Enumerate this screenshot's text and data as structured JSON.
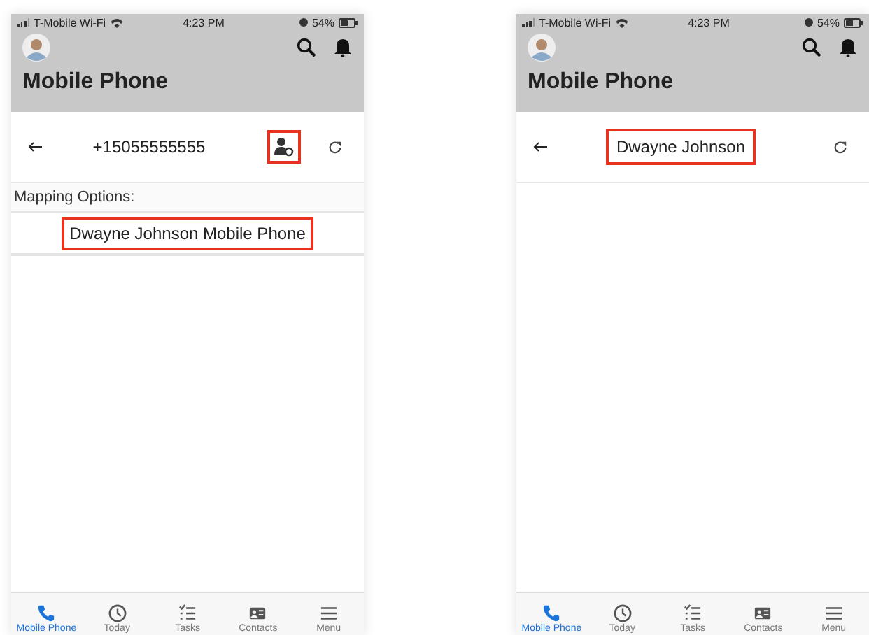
{
  "screens": [
    {
      "status_bar": {
        "carrier": "T-Mobile Wi-Fi",
        "time": "4:23 PM",
        "battery": "54%"
      },
      "header": {
        "title": "Mobile Phone"
      },
      "toolbar": {
        "title": "+15055555555",
        "title_highlighted": false,
        "actions": [
          {
            "kind": "map-contact",
            "highlighted": true
          },
          {
            "kind": "refresh",
            "highlighted": false
          }
        ]
      },
      "mapping_label": "Mapping Options:",
      "options": [
        {
          "label": "Dwayne Johnson Mobile Phone",
          "highlighted": true
        }
      ],
      "tabs": [
        {
          "label": "Mobile Phone",
          "kind": "phone",
          "selected": true
        },
        {
          "label": "Today",
          "kind": "clock",
          "selected": false
        },
        {
          "label": "Tasks",
          "kind": "tasks",
          "selected": false
        },
        {
          "label": "Contacts",
          "kind": "contacts",
          "selected": false
        },
        {
          "label": "Menu",
          "kind": "menu",
          "selected": false
        }
      ]
    },
    {
      "status_bar": {
        "carrier": "T-Mobile Wi-Fi",
        "time": "4:23 PM",
        "battery": "54%"
      },
      "header": {
        "title": "Mobile Phone"
      },
      "toolbar": {
        "title": "Dwayne Johnson",
        "title_highlighted": true,
        "actions": [
          {
            "kind": "refresh",
            "highlighted": false
          }
        ]
      },
      "tabs": [
        {
          "label": "Mobile Phone",
          "kind": "phone",
          "selected": true
        },
        {
          "label": "Today",
          "kind": "clock",
          "selected": false
        },
        {
          "label": "Tasks",
          "kind": "tasks",
          "selected": false
        },
        {
          "label": "Contacts",
          "kind": "contacts",
          "selected": false
        },
        {
          "label": "Menu",
          "kind": "menu",
          "selected": false
        }
      ]
    }
  ]
}
